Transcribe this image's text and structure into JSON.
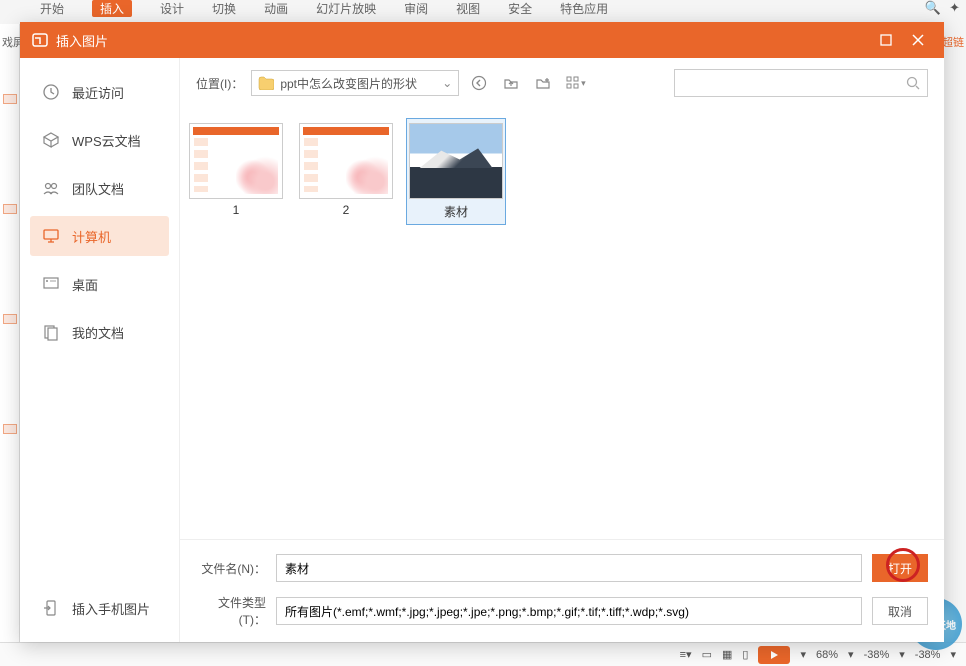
{
  "bg": {
    "tabs": [
      "",
      "开始",
      "插入",
      "设计",
      "切换",
      "动画",
      "幻灯片放映",
      "审阅",
      "视图",
      "安全",
      "特色应用"
    ],
    "left_label": "戏屏",
    "right_label": "超链",
    "status": {
      "zoom1": "68%",
      "zoom2": "-38%",
      "zoom3": "-38%"
    }
  },
  "dialog": {
    "title": "插入图片",
    "sidebar": [
      {
        "icon": "clock",
        "label": "最近访问"
      },
      {
        "icon": "cube",
        "label": "WPS云文档"
      },
      {
        "icon": "people",
        "label": "团队文档"
      },
      {
        "icon": "monitor",
        "label": "计算机"
      },
      {
        "icon": "desktop",
        "label": "桌面"
      },
      {
        "icon": "docs",
        "label": "我的文档"
      }
    ],
    "bottom_link": "插入手机图片",
    "location_label": "位置(I)：",
    "location_value": "ppt中怎么改变图片的形状",
    "files": [
      {
        "name": "1",
        "kind": "ppt"
      },
      {
        "name": "2",
        "kind": "ppt"
      },
      {
        "name": "素材",
        "kind": "photo",
        "selected": true
      }
    ],
    "filename_label": "文件名(N)：",
    "filename_value": "素材",
    "filetype_label": "文件类型(T)：",
    "filetype_value": "所有图片(*.emf;*.wmf;*.jpg;*.jpeg;*.jpe;*.png;*.bmp;*.gif;*.tif;*.tiff;*.wdp;*.svg)",
    "open": "打开",
    "cancel": "取消"
  },
  "watermark": "系统天地"
}
